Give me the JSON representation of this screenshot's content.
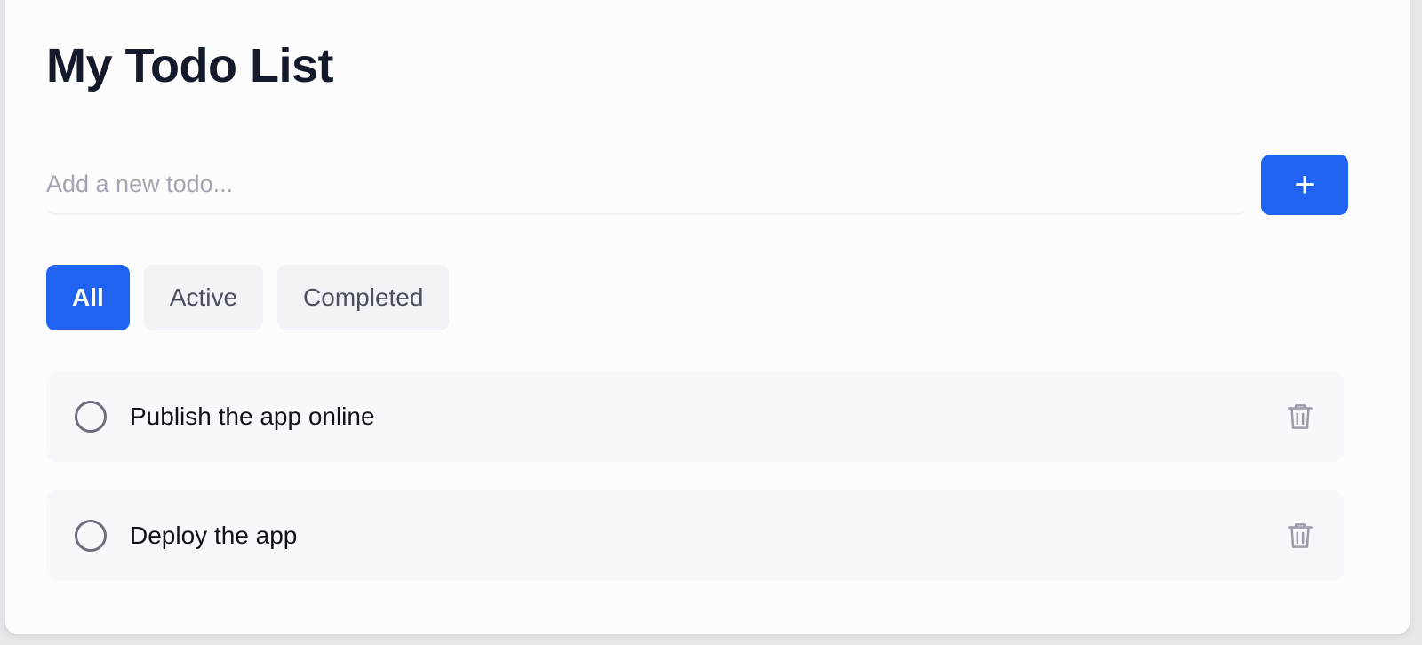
{
  "header": {
    "title": "My Todo List"
  },
  "new_todo": {
    "placeholder": "Add a new todo...",
    "value": "",
    "add_label": "+"
  },
  "filters": [
    {
      "label": "All",
      "active": true
    },
    {
      "label": "Active",
      "active": false
    },
    {
      "label": "Completed",
      "active": false
    }
  ],
  "todos": [
    {
      "text": "Publish the app online",
      "completed": false
    },
    {
      "text": "Deploy the app",
      "completed": false
    }
  ],
  "colors": {
    "accent": "#1f63f0",
    "title": "#141a2b",
    "item_background": "#f8f8fc",
    "filter_inactive_background": "#f2f3f6",
    "checkbox_border": "#6d707c",
    "trash_icon": "#9a9da8"
  },
  "icons": {
    "add": "plus-icon",
    "checkbox": "circle-outline-icon",
    "delete": "trash-icon"
  }
}
